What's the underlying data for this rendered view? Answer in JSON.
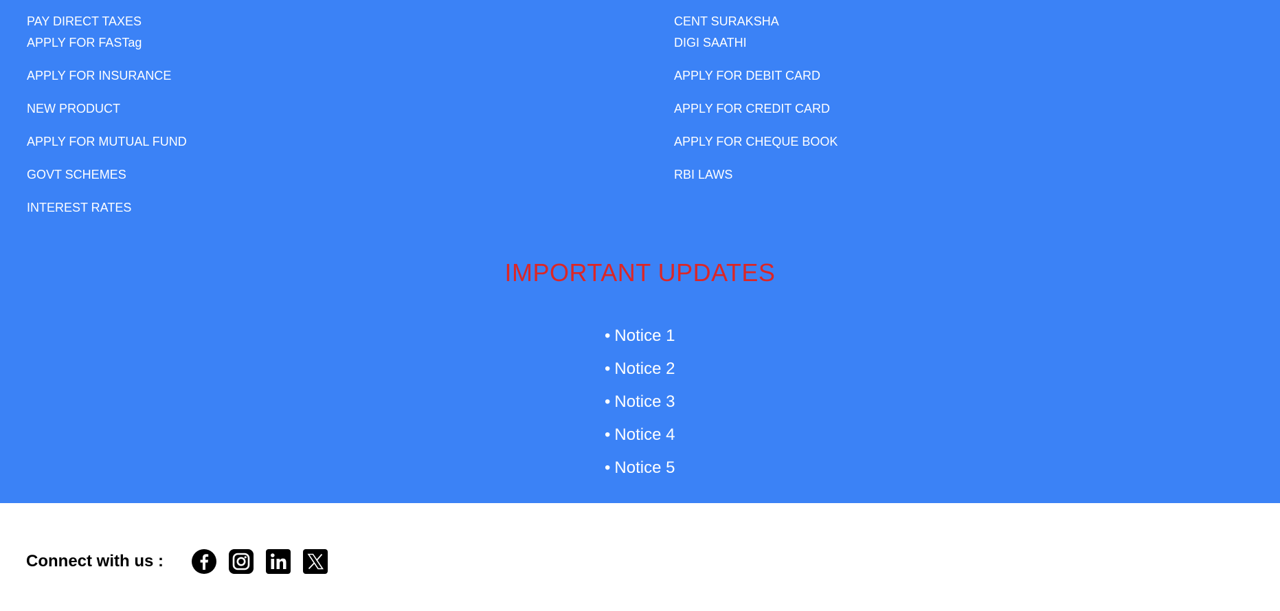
{
  "quick_links": {
    "left": [
      "PAY DIRECT TAXES",
      "APPLY FOR FASTag",
      "APPLY FOR INSURANCE",
      "NEW PRODUCT",
      "APPLY FOR MUTUAL FUND",
      "GOVT SCHEMES",
      "INTEREST RATES"
    ],
    "right": [
      "CENT SURAKSHA",
      "DIGI SAATHI",
      "APPLY FOR DEBIT CARD",
      "APPLY FOR CREDIT CARD",
      "APPLY FOR CHEQUE BOOK",
      "RBI LAWS"
    ]
  },
  "updates": {
    "title": "IMPORTANT UPDATES",
    "bullet": "•",
    "notices": [
      "Notice 1",
      "Notice 2",
      "Notice 3",
      "Notice 4",
      "Notice 5"
    ]
  },
  "connect": {
    "label": "Connect with us :",
    "icons": [
      "facebook-icon",
      "instagram-icon",
      "linkedin-icon",
      "x-twitter-icon"
    ]
  },
  "colors": {
    "section_background": "#3b82f6",
    "updates_title": "#dc2626",
    "link_text": "#ffffff",
    "footer_background": "#ffffff"
  }
}
